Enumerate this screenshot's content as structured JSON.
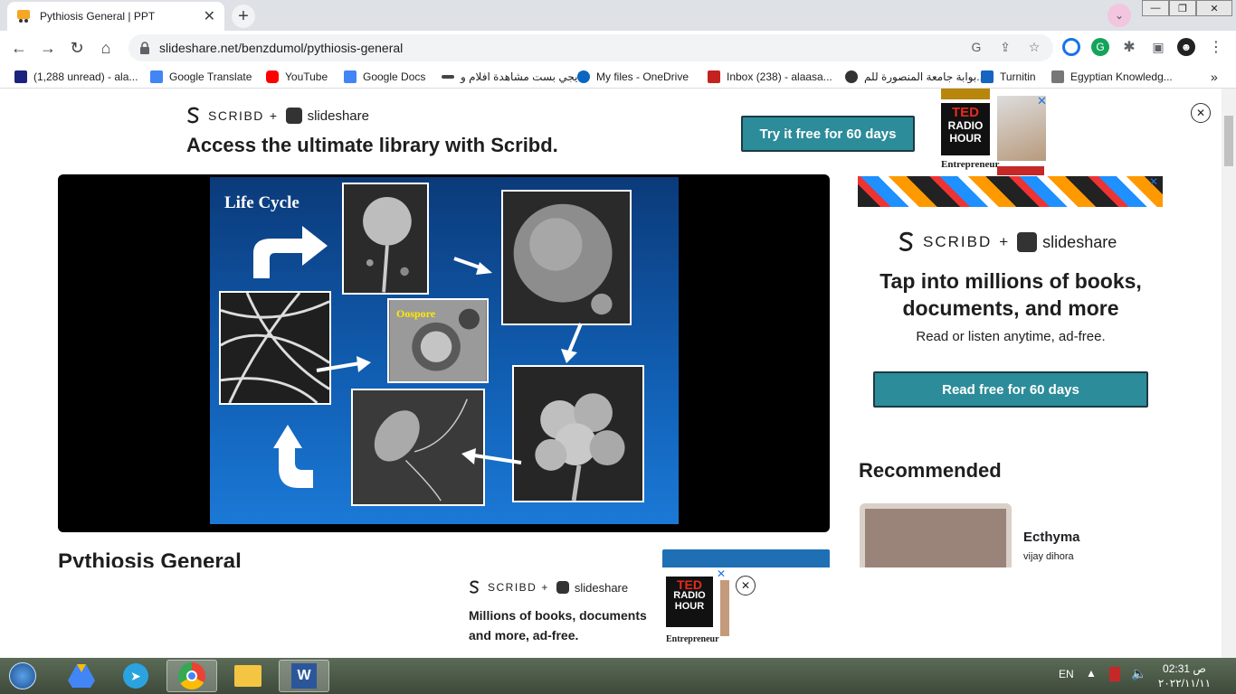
{
  "browser": {
    "tab_title": "Pythiosis General | PPT",
    "tab_close": "✕",
    "new_tab": "+",
    "url": "slideshare.net/benzdumol/pythiosis-general",
    "bookmarks": [
      {
        "label": "(1,288 unread) - ala...",
        "color": "#1a237e"
      },
      {
        "label": "Google Translate",
        "color": "#4285f4"
      },
      {
        "label": "YouTube",
        "color": "#ff0000"
      },
      {
        "label": "Google Docs",
        "color": "#4285f4"
      },
      {
        "label": "ايجي بست مشاهدة افلام و...",
        "color": "#444444"
      },
      {
        "label": "My files - OneDrive",
        "color": "#0a66c2"
      },
      {
        "label": "Inbox (238) - alaasa...",
        "color": "#c5221f"
      },
      {
        "label": "بوابة جامعة المنصورة للم...",
        "color": "#333333"
      },
      {
        "label": "Turnitin",
        "color": "#1565c0"
      },
      {
        "label": "Egyptian Knowledg...",
        "color": "#777777"
      }
    ],
    "bookmarks_more": "»"
  },
  "top_banner": {
    "scribd": "SCRIBD",
    "plus": "+",
    "slideshare": "slideshare",
    "headline": "Access the ultimate library with Scribd.",
    "cta": "Try it free for 60 days"
  },
  "ad_magazine": {
    "ted_line1": "TED",
    "ted_line2": "RADIO",
    "ted_line3": "HOUR",
    "entrepreneur": "Entrepreneur"
  },
  "slide": {
    "title": "Life Cycle",
    "oospore_label": "Oospore"
  },
  "doc": {
    "title": "Pythiosis General"
  },
  "side_ad": {
    "scribd": "SCRIBD",
    "plus": "+",
    "slideshare": "slideshare",
    "headline": "Tap into millions of books, documents, and more",
    "subline": "Read or listen anytime, ad-free.",
    "cta": "Read free for 60 days"
  },
  "recommended": {
    "heading": "Recommended",
    "items": [
      {
        "title": "Ecthyma",
        "author": "vijay dihora"
      }
    ]
  },
  "bottom_ad": {
    "scribd": "SCRIBD",
    "plus": "+",
    "slideshare": "slideshare",
    "headline": "Millions of books, documents and more, ad-free."
  },
  "taskbar": {
    "lang": "EN",
    "time": "02:31 ص",
    "date": "٢٠٢٢/١١/١١"
  },
  "colors": {
    "teal": "#2c8c9a",
    "slide_blue": "#1160b5"
  }
}
